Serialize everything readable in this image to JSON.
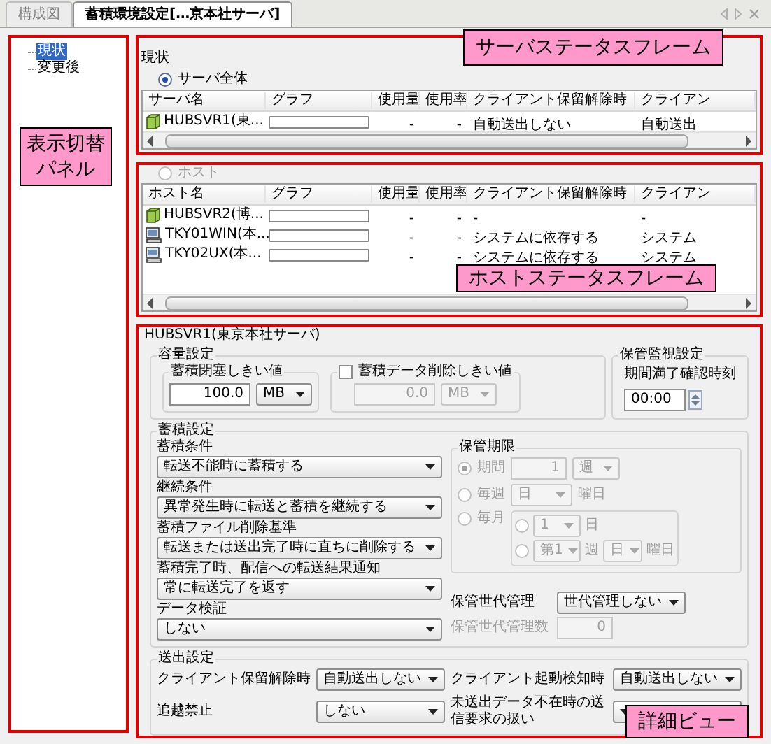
{
  "tabs": [
    {
      "label": "構成図",
      "selected": false
    },
    {
      "label": "蓄積環境設定[…京本社サーバ]",
      "selected": true
    }
  ],
  "tree": {
    "callout": "表示切替パネル",
    "items": [
      {
        "label": "現状",
        "selected": true
      },
      {
        "label": "変更後",
        "selected": false
      }
    ]
  },
  "server_frame": {
    "callout": "サーバステータスフレーム",
    "title": "現状",
    "scope": {
      "label": "サーバ全体",
      "selected": true,
      "disabled": false
    },
    "columns": [
      "サーバ名",
      "グラフ",
      "使用量",
      "使用率",
      "クライアント保留解除時",
      "クライアン"
    ],
    "rows": [
      {
        "kind": "server",
        "name": "HUBSVR1(東...",
        "level": 0,
        "usage": "-",
        "rate": "-",
        "release": "自動送出しない",
        "column_6": "自動送出"
      }
    ]
  },
  "host_frame": {
    "callout": "ホストステータスフレーム",
    "scope": {
      "label": "ホスト",
      "selected": false,
      "disabled": true
    },
    "columns": [
      "ホスト名",
      "グラフ",
      "使用量",
      "使用率",
      "クライアント保留解除時",
      "クライアン"
    ],
    "rows": [
      {
        "kind": "server",
        "name": "HUBSVR2(博...",
        "level": 0,
        "usage": "-",
        "rate": "-",
        "release": "-",
        "column_6": "-"
      },
      {
        "kind": "pc",
        "name": "TKY01WIN(本...",
        "level": 0,
        "usage": "-",
        "rate": "-",
        "release": "システムに依存する",
        "column_6": "システム"
      },
      {
        "kind": "pc",
        "name": "TKY02UX(本...",
        "level": 0,
        "usage": "-",
        "rate": "-",
        "release": "システムに依存する",
        "column_6": "システム"
      }
    ]
  },
  "detail": {
    "callout": "詳細ビュー",
    "title": "HUBSVR1(東京本社サーバ)",
    "capacity": {
      "title": "容量設定",
      "block": {
        "title": "蓄積閉塞しきい値",
        "value": "100.0",
        "unit": "MB",
        "disabled": false
      },
      "delete": {
        "label": "蓄積データ削除しきい値",
        "checked": false,
        "value": "0.0",
        "unit": "MB",
        "disabled": true
      }
    },
    "monitor": {
      "title": "保管監視設定",
      "label": "期間満了確認時刻",
      "value": "00:00"
    },
    "storage": {
      "title": "蓄積設定",
      "fields": [
        {
          "label": "蓄積条件",
          "value": "転送不能時に蓄積する"
        },
        {
          "label": "継続条件",
          "value": "異常発生時に転送と蓄積を継続する"
        },
        {
          "label": "蓄積ファイル削除基準",
          "value": "転送または送出完了時に直ちに削除する"
        },
        {
          "label": "蓄積完了時、配信への転送結果通知",
          "value": "常に転送完了を返す"
        },
        {
          "label": "データ検証",
          "value": "しない"
        }
      ],
      "retention": {
        "title": "保管期限",
        "disabled": true,
        "period": {
          "label": "期間",
          "selected": true,
          "value": "1",
          "unit": "週"
        },
        "weekly": {
          "label": "毎週",
          "selected": false,
          "value": "日",
          "suffix": "曜日"
        },
        "monthly": {
          "label": "毎月",
          "selected": false,
          "day": {
            "selected": false,
            "value": "1",
            "suffix": "日"
          },
          "week": {
            "selected": false,
            "value": "第1",
            "mid": "週",
            "day": "日",
            "suffix": "曜日"
          }
        }
      },
      "generation": {
        "label": "保管世代管理",
        "value": "世代管理しない",
        "disabled": false
      },
      "generation_count": {
        "label": "保管世代管理数",
        "value": "0",
        "disabled": true
      }
    },
    "send": {
      "title": "送出設定",
      "fields": [
        {
          "label": "クライアント保留解除時",
          "value": "自動送出しない"
        },
        {
          "label": "クライアント起動検知時",
          "value": "自動送出しない"
        },
        {
          "label": "追越禁止",
          "value": "しない"
        },
        {
          "label": "未送出データ不在時の送信要求の扱い"
        }
      ]
    }
  }
}
